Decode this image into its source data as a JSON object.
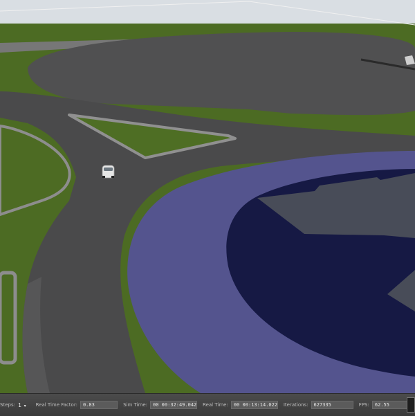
{
  "status_bar": {
    "steps_label": "Steps:",
    "steps_value": "1",
    "rtf_label": "Real Time Factor:",
    "rtf_value": "0.83",
    "sim_time_label": "Sim Time:",
    "sim_time_value": "00 00:32:49.042",
    "real_time_label": "Real Time:",
    "real_time_value": "00 00:13:14.022",
    "iterations_label": "Iterations:",
    "iterations_value": "627335",
    "fps_label": "FPS:",
    "fps_value": "62.55"
  },
  "scene": {
    "sky_color": "#d9dee3",
    "grass_color": "#4c6b23",
    "asphalt_color": "#4b4b4c",
    "curb_color": "#8d8d8d",
    "water_shallow_color": "#54548e",
    "water_deep_color": "#161944"
  }
}
